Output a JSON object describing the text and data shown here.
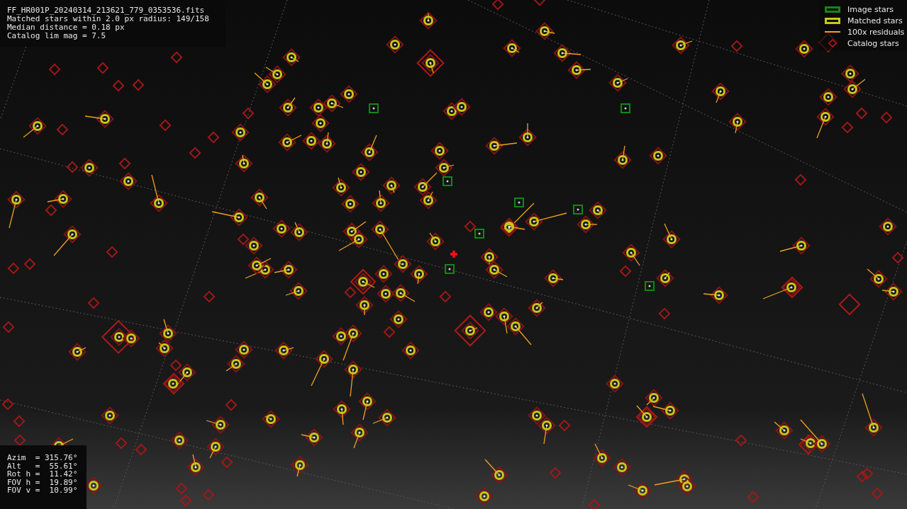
{
  "header": {
    "lines": [
      "FF_HR001P_20240314_213621_779_0353536.fits",
      "Matched stars within 2.0 px radius: 149/158",
      "Median distance = 0.18 px",
      "Catalog lim mag = 7.5"
    ]
  },
  "legend": [
    {
      "kind": "image",
      "label": "Image stars"
    },
    {
      "kind": "matched",
      "label": "Matched stars"
    },
    {
      "kind": "residual",
      "label": "100x residuals"
    },
    {
      "kind": "catalog",
      "label": "Catalog stars"
    }
  ],
  "pointing": {
    "lines": [
      "Azim  = 315.76°",
      "Alt   =  55.61°",
      "Rot h =  11.42°",
      "FOV h =  19.89°",
      "FOV v =  10.99°"
    ]
  }
}
